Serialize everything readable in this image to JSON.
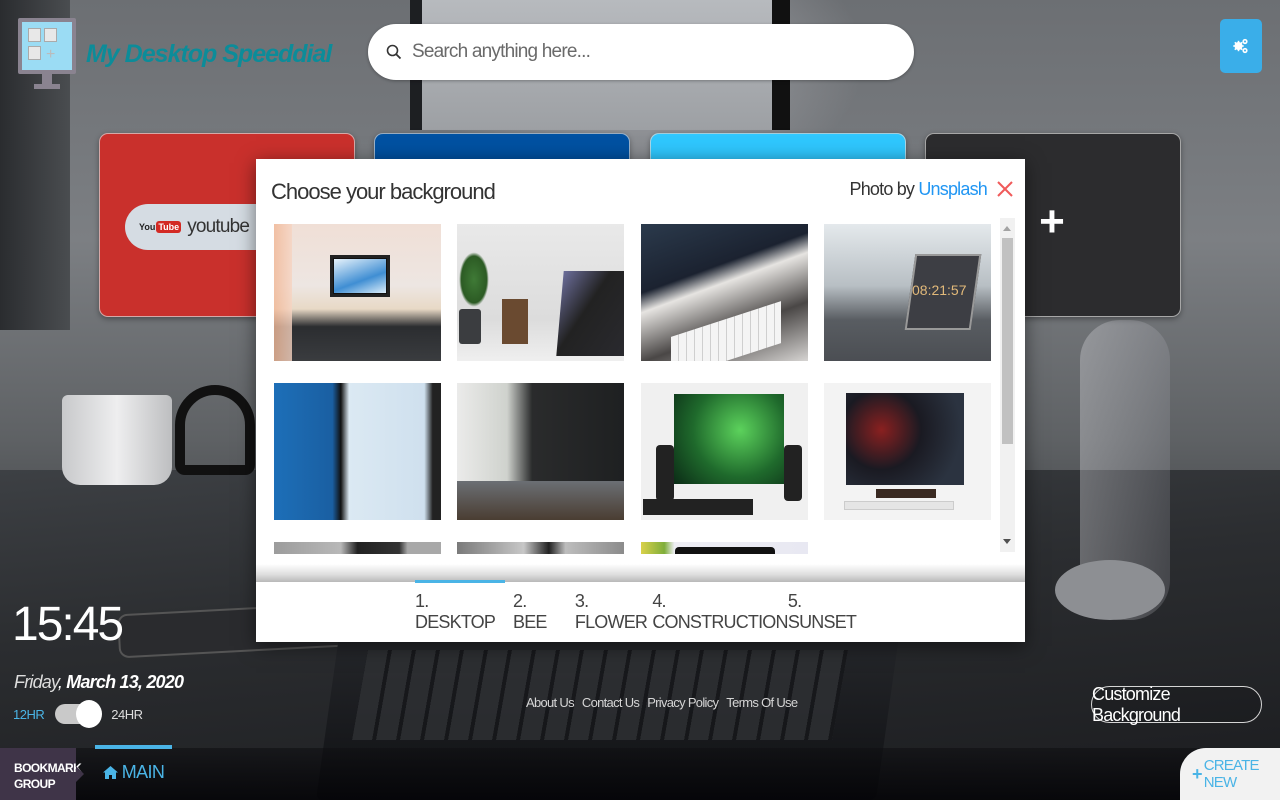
{
  "app": {
    "title": "My Desktop Speeddial"
  },
  "search": {
    "placeholder": "Search anything here...",
    "value": ""
  },
  "settings": {
    "icon": "gears-icon"
  },
  "tiles": [
    {
      "name": "youtube",
      "label": "youtube",
      "logo_you": "You",
      "logo_tube": "Tube",
      "color": "#c9302c"
    },
    {
      "name": "blue-tile",
      "label": "",
      "color": "#0052a3"
    },
    {
      "name": "cyan-tile",
      "label": "",
      "color": "#30c8ff"
    },
    {
      "name": "add-tile",
      "label": "+",
      "color": "#2c2c2e"
    }
  ],
  "modal": {
    "title": "Choose your background",
    "credit_prefix": "Photo by",
    "credit_link": "Unsplash",
    "close_icon": "close-icon",
    "thumbnails": [
      {
        "alt": "White desk with iMac by window"
      },
      {
        "alt": "Plant, pen holder and laptop showing 08:02:01"
      },
      {
        "alt": "iMac with keyboard and Mac mini"
      },
      {
        "alt": "Laptop showing 08:21:57 by window"
      },
      {
        "alt": "Person at iMac"
      },
      {
        "alt": "Laptop with plant shadow"
      },
      {
        "alt": "Monitor with green fern and speakers"
      },
      {
        "alt": "Monitor with Creative artwork"
      },
      {
        "alt": "Partially visible desk photo"
      },
      {
        "alt": "Partially visible laptop photo"
      },
      {
        "alt": "Partially visible monitor with flowers"
      }
    ],
    "tabs": [
      {
        "label": "1. DESKTOP",
        "active": true
      },
      {
        "label": "2. BEE",
        "active": false
      },
      {
        "label": "3. FLOWER",
        "active": false
      },
      {
        "label": "4. CONSTRUCTION",
        "active": false
      },
      {
        "label": "5. SUNSET",
        "active": false
      }
    ]
  },
  "clock": {
    "time": "15:45",
    "day": "Friday",
    "separator": ", ",
    "date": "March 13, 2020",
    "format_12": "12HR",
    "format_24": "24HR",
    "format_24_selected": true
  },
  "footer": {
    "links": [
      "About Us",
      "Contact Us",
      "Privacy Policy",
      "Terms Of Use"
    ]
  },
  "customize_background_label": "Customize Background",
  "bottom_bar": {
    "group_label_line1": "BOOKMARK",
    "group_label_line2": "GROUP",
    "main_tab_label": "MAIN",
    "create_new_label": "CREATE NEW"
  },
  "colors": {
    "accent": "#4ab4e6",
    "logo_text": "#0c8c99",
    "settings_button": "#3aaee9",
    "close": "#f05a5a",
    "link": "#2196f3",
    "bookmark_group": "#3f3448"
  }
}
